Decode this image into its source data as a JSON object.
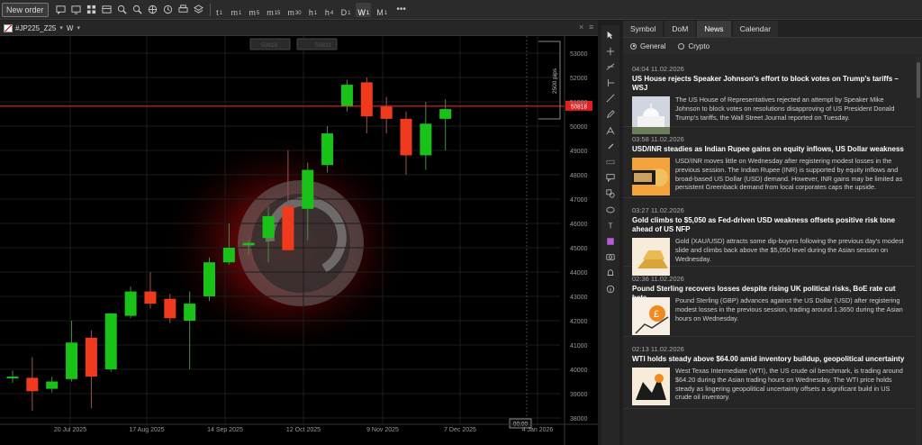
{
  "toolbar": {
    "new_order_label": "New order",
    "icons": [
      "chat-icon",
      "monitor-icon",
      "grid-icon",
      "layout-icon",
      "zoom-in-icon",
      "zoom-out-icon",
      "crosshair-icon",
      "clock-icon",
      "print-icon",
      "layers-icon"
    ],
    "timeframes": [
      {
        "label": "t",
        "sub": "1",
        "active": false
      },
      {
        "label": "m",
        "sub": "1",
        "active": false
      },
      {
        "label": "m",
        "sub": "5",
        "active": false
      },
      {
        "label": "m",
        "sub": "15",
        "active": false
      },
      {
        "label": "m",
        "sub": "30",
        "active": false
      },
      {
        "label": "h",
        "sub": "1",
        "active": false
      },
      {
        "label": "h",
        "sub": "4",
        "active": false
      },
      {
        "label": "D",
        "sub": "1",
        "active": false
      },
      {
        "label": "W",
        "sub": "1",
        "active": true
      },
      {
        "label": "M",
        "sub": "1",
        "active": false
      }
    ],
    "more_label": "•••"
  },
  "chart_header": {
    "symbol": "#JP225_Z25",
    "timeframe": "W",
    "caret": "▾",
    "close_icon": "×",
    "menu_icon": "≡"
  },
  "chart_data": {
    "type": "candlestick",
    "symbol": "#JP225_Z25",
    "timeframe": "W",
    "y_ticks": [
      38000,
      39000,
      40000,
      41000,
      42000,
      43000,
      44000,
      45000,
      46000,
      47000,
      48000,
      49000,
      50000,
      51000,
      52000,
      53000
    ],
    "x_ticks": [
      "20 Jul 2025",
      "17 Aug 2025",
      "14 Sep 2025",
      "12 Oct 2025",
      "9 Nov 2025",
      "7 Dec 2025",
      "4 Jan 2026"
    ],
    "current_price_label": "50818",
    "current_price": 50818,
    "range_label": "2500 pips",
    "bid_label": "50818",
    "ask_label": "50831",
    "bottom_marker_label": "00:00",
    "colors": {
      "up": "#19c219",
      "down": "#f03a1e",
      "price_line": "#ff2a2a",
      "axis_text": "#9a9a9a",
      "grid": "#1c1c1c"
    },
    "candles": [
      {
        "o": 39700,
        "h": 39950,
        "l": 39450,
        "c": 39700
      },
      {
        "o": 39650,
        "h": 40500,
        "l": 38300,
        "c": 39100
      },
      {
        "o": 39200,
        "h": 39700,
        "l": 39050,
        "c": 39500
      },
      {
        "o": 39600,
        "h": 42000,
        "l": 39500,
        "c": 41100
      },
      {
        "o": 41300,
        "h": 41600,
        "l": 38400,
        "c": 39700
      },
      {
        "o": 40000,
        "h": 42300,
        "l": 39900,
        "c": 42300
      },
      {
        "o": 42200,
        "h": 43400,
        "l": 42100,
        "c": 43200
      },
      {
        "o": 43200,
        "h": 44000,
        "l": 42500,
        "c": 42700
      },
      {
        "o": 42900,
        "h": 43100,
        "l": 41900,
        "c": 42100
      },
      {
        "o": 42000,
        "h": 43200,
        "l": 40000,
        "c": 42700
      },
      {
        "o": 43000,
        "h": 44600,
        "l": 42800,
        "c": 44400
      },
      {
        "o": 44400,
        "h": 46000,
        "l": 44300,
        "c": 45000
      },
      {
        "o": 45100,
        "h": 45300,
        "l": 44700,
        "c": 45200
      },
      {
        "o": 45400,
        "h": 46700,
        "l": 44400,
        "c": 46300
      },
      {
        "o": 46700,
        "h": 49000,
        "l": 45400,
        "c": 44900
      },
      {
        "o": 46600,
        "h": 48500,
        "l": 45300,
        "c": 48200
      },
      {
        "o": 48400,
        "h": 50000,
        "l": 48100,
        "c": 49700
      },
      {
        "o": 50800,
        "h": 51900,
        "l": 50600,
        "c": 51700
      },
      {
        "o": 51800,
        "h": 52000,
        "l": 49700,
        "c": 50400
      },
      {
        "o": 50800,
        "h": 51200,
        "l": 49700,
        "c": 50300
      },
      {
        "o": 50300,
        "h": 50600,
        "l": 48000,
        "c": 48800
      },
      {
        "o": 48800,
        "h": 51000,
        "l": 48200,
        "c": 50100
      },
      {
        "o": 50300,
        "h": 51100,
        "l": 49000,
        "c": 50700
      }
    ]
  },
  "tools": [
    "cursor-icon",
    "crosshair-tool-icon",
    "line-tool-icon",
    "ray-tool-icon",
    "trendline-icon",
    "pencil-icon",
    "fibonacci-icon",
    "brush-icon",
    "measure-icon",
    "callout-icon",
    "shapes-icon",
    "ellipse-icon",
    "text-icon",
    "color-swatch-icon",
    "camera-icon",
    "alert-icon",
    "info-icon"
  ],
  "panel": {
    "tabs": [
      {
        "label": "Symbol",
        "active": false
      },
      {
        "label": "DoM",
        "active": false
      },
      {
        "label": "News",
        "active": true
      },
      {
        "label": "Calendar",
        "active": false
      }
    ],
    "filters": [
      {
        "label": "General",
        "selected": true
      },
      {
        "label": "Crypto",
        "selected": false
      }
    ],
    "news": [
      {
        "time": "04:04 11.02.2026",
        "title": "US House rejects Speaker Johnson's effort to block votes on Trump's tariffs – WSJ",
        "body": "The US House of Representatives rejected an attempt by Speaker Mike Johnson to block votes on resolutions disapproving of US President Donald Trump's tariffs, the Wall Street Journal reported on Tuesday.",
        "thumb": "capitol"
      },
      {
        "time": "03:58 11.02.2026",
        "title": "USD/INR steadies as Indian Rupee gains on equity inflows, US Dollar weakness",
        "body": "USD/INR moves little on Wednesday after registering modest losses in the previous session. The Indian Rupee (INR) is supported by equity inflows and broad-based US Dollar (USD) demand. However, INR gains may be limited as persistent Greenback demand from local corporates caps the upside.",
        "thumb": "rupee"
      },
      {
        "time": "03:27 11.02.2026",
        "title": "Gold climbs to $5,050 as Fed-driven USD weakness offsets positive risk tone ahead of US NFP",
        "body": "Gold (XAU/USD) attracts some dip-buyers following the previous day's modest slide and climbs back above the $5,050 level during the Asian session on Wednesday.",
        "thumb": "gold"
      },
      {
        "time": "02:36 11.02.2026",
        "title": "Pound Sterling recovers losses despite rising UK political risks, BoE rate cut bets",
        "body": "Pound Sterling (GBP) advances against the US Dollar (USD) after registering modest losses in the previous session, trading around 1.3650 during the Asian hours on Wednesday.",
        "thumb": "pound"
      },
      {
        "time": "02:13 11.02.2026",
        "title": "WTI holds steady above $64.00 amid inventory buildup, geopolitical uncertainty",
        "body": "West Texas Intermediate (WTI), the US crude oil benchmark, is trading around $64.20 during the Asian trading hours on Wednesday. The WTI price holds steady as lingering geopolitical uncertainty offsets a significant build in US crude oil inventory.",
        "thumb": "oil"
      }
    ]
  }
}
